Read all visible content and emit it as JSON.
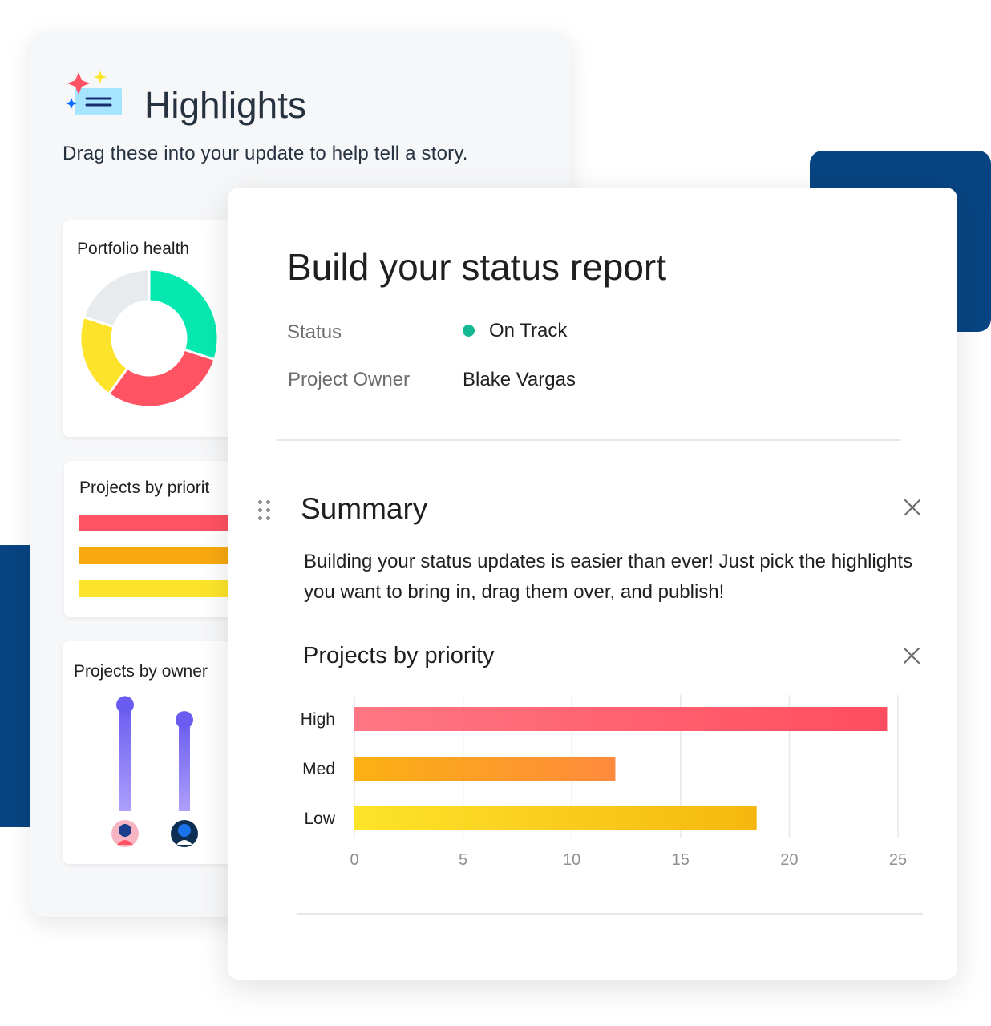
{
  "highlights": {
    "title": "Highlights",
    "subtitle": "Drag these into your update to help tell a story.",
    "cards": {
      "portfolio_health": {
        "title": "Portfolio health",
        "segments": [
          {
            "color": "#07e8b0",
            "value": 30
          },
          {
            "color": "#ff5263",
            "value": 30
          },
          {
            "color": "#fde42a",
            "value": 20
          },
          {
            "color": "#e8ebee",
            "value": 20
          }
        ]
      },
      "projects_by_priority": {
        "title": "Projects by priorit",
        "bar_colors": [
          "#ff5263",
          "#f8a90f",
          "#fde42a"
        ]
      },
      "projects_by_owner": {
        "title": "Projects by owner",
        "levels": [
          0.78,
          0.67,
          0.58
        ],
        "avatar_backgrounds": [
          "#f7b5c3",
          "#0c2e52",
          "#f7b5c3"
        ]
      }
    },
    "icon": "sparkle-message-icon"
  },
  "report": {
    "title": "Build your status report",
    "fields": {
      "status_label": "Status",
      "status_value": "On Track",
      "status_color": "#14b892",
      "owner_label": "Project Owner",
      "owner_value": "Blake Vargas"
    },
    "summary": {
      "title": "Summary",
      "text": "Building your status updates is easier than ever! Just pick the highlights you want to bring in, drag them over, and publish!"
    },
    "priority_section": {
      "title": "Projects by priority"
    }
  },
  "chart_data": {
    "type": "bar",
    "orientation": "horizontal",
    "title": "Projects by priority",
    "categories": [
      "High",
      "Med",
      "Low"
    ],
    "values": [
      24.5,
      12,
      18.5
    ],
    "colors": [
      [
        "#ff7784",
        "#ff4d5f"
      ],
      [
        "#fbb112",
        "#ff8a3d"
      ],
      [
        "#fde42a",
        "#f6b70f"
      ]
    ],
    "xlim": [
      0,
      25
    ],
    "xticks": [
      "0",
      "5",
      "10",
      "15",
      "20",
      "25"
    ],
    "grid": true,
    "legend": "none"
  }
}
